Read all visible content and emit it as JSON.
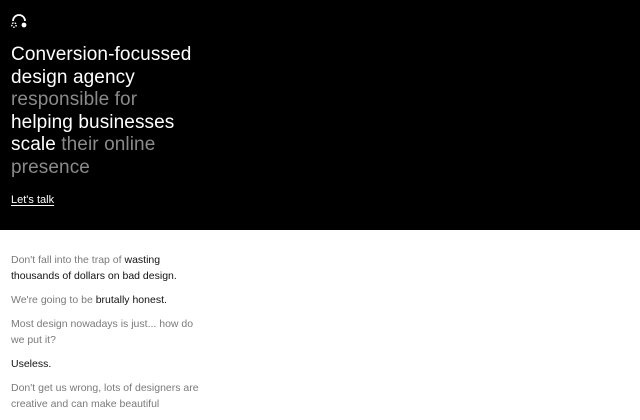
{
  "logo": {
    "icon": "headphones-logo-icon"
  },
  "hero": {
    "line1": "Conversion-focussed",
    "line2": "design agency",
    "line3_dim": "responsible for",
    "line4": "helping businesses",
    "line5_bright": "scale",
    "line5_dim": " their online",
    "line6_dim": "presence",
    "cta_label": "Let's talk"
  },
  "copy": {
    "p1_dim": "Don't fall into the trap of ",
    "p1_em": "wasting thousands of dollars on bad design",
    "p1_end": ".",
    "p2_dim": "We're going to be ",
    "p2_em": "brutally honest",
    "p2_end": ".",
    "p3": "Most design nowadays is just... how do we put it?",
    "p4": "Useless.",
    "p5": "Don't get us wrong, lots of designers are creative and can make beautiful"
  },
  "colors": {
    "hero_bg": "#000000",
    "hero_text": "#ffffff",
    "dim_text": "#8a8a8a",
    "body_dim": "#7a7a7a",
    "body_em": "#111111"
  }
}
